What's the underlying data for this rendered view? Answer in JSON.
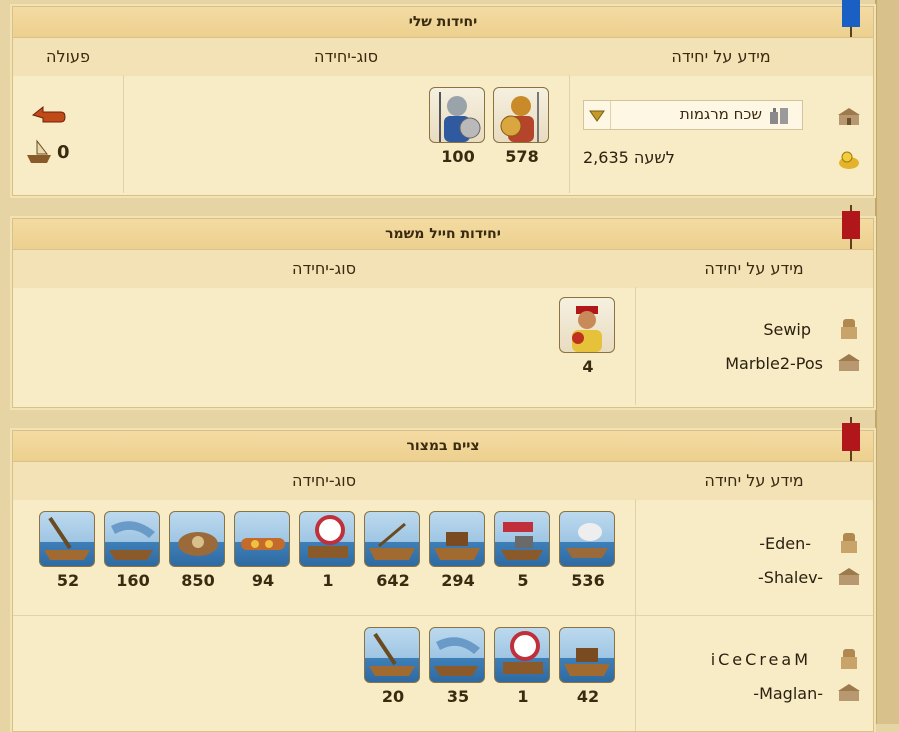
{
  "my_units": {
    "title": "יחידות שלי",
    "headers": {
      "info": "מידע על יחידה",
      "type": "סוג-יחידה",
      "action": "פעולה"
    },
    "location_select": "שכח מרגמות",
    "income": "2,635 לשעה",
    "units": [
      {
        "icon": "hoplite-bronze-helmet-icon",
        "count": "578"
      },
      {
        "icon": "hoplite-steel-helmet-icon",
        "count": "100"
      }
    ],
    "action_count": "0"
  },
  "guard_units": {
    "title": "יחידות חייל משמר",
    "headers": {
      "info": "מידע על יחידה",
      "type": "סוג-יחידה"
    },
    "player": "Sewip",
    "town": "Marble2-Pos",
    "units": [
      {
        "icon": "slinger-icon",
        "count": "4"
      }
    ]
  },
  "blockade": {
    "title": "ציים במצור",
    "headers": {
      "info": "מידע על יחידה",
      "type": "סוג-יחידה"
    },
    "rows": [
      {
        "player": "-Eden-",
        "town": "-Shalev-",
        "units": [
          {
            "icon": "steam-ram-ship-icon",
            "count": "536"
          },
          {
            "icon": "mortar-ship-icon",
            "count": "5"
          },
          {
            "icon": "ballista-ship-icon",
            "count": "294"
          },
          {
            "icon": "catapult-ship-icon",
            "count": "642"
          },
          {
            "icon": "balloon-carrier-icon",
            "count": "1"
          },
          {
            "icon": "paddle-speedboat-icon",
            "count": "94"
          },
          {
            "icon": "diving-boat-icon",
            "count": "850"
          },
          {
            "icon": "rocket-ship-icon",
            "count": "160"
          },
          {
            "icon": "fire-ship-icon",
            "count": "52"
          }
        ]
      },
      {
        "player": "iCeCreaM",
        "town": "-Maglan-",
        "units": [
          {
            "icon": "ballista-ship-icon",
            "count": "42"
          },
          {
            "icon": "balloon-carrier-icon",
            "count": "1"
          },
          {
            "icon": "rocket-ship-icon",
            "count": "35"
          },
          {
            "icon": "fire-ship-icon",
            "count": "20"
          }
        ]
      }
    ]
  },
  "colors": {
    "blue_flag": "#1a5fc4",
    "red_flag": "#b0161a",
    "panel": "#f8ecc6",
    "header": "#f3e2b6"
  }
}
